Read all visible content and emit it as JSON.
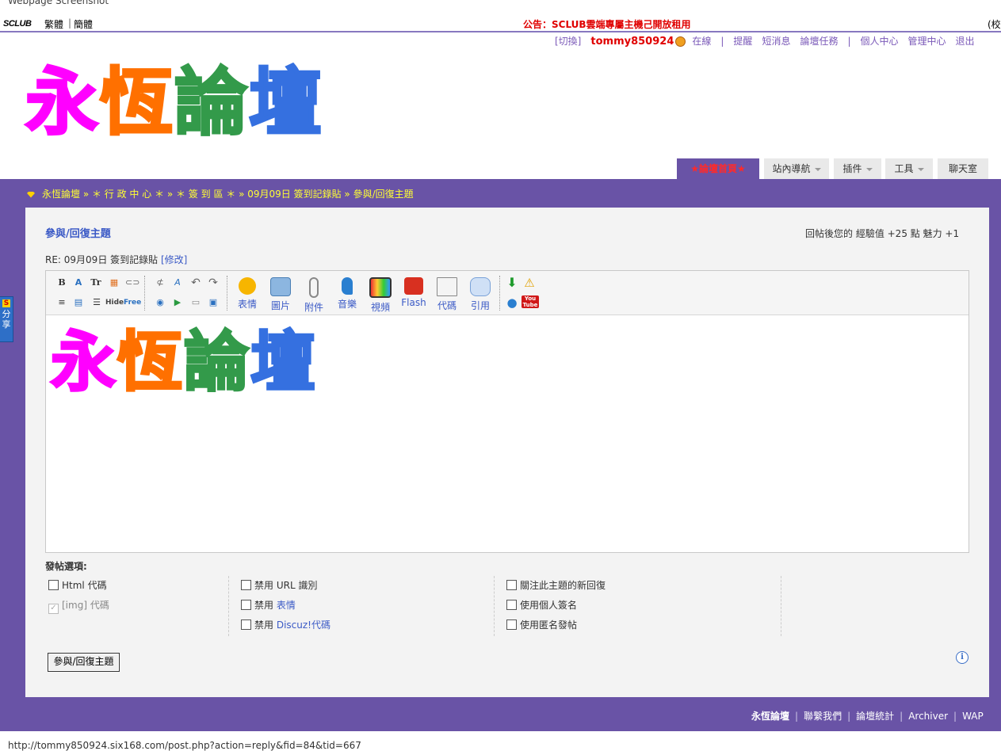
{
  "watermark": "Webpage Screenshot",
  "topbar": {
    "logo": "SCLUB",
    "lang_traditional": "繁體",
    "lang_separator": "|",
    "lang_simplified": "簡體",
    "announcement": "公告：SCLUB雲端專屬主機己開放租用",
    "right_fragment": "(校"
  },
  "user_nav": {
    "switch": "[切換]",
    "username": "tommy850924",
    "online": "在線",
    "sep": "|",
    "reminders": "提醒",
    "messages": "短消息",
    "tasks": "論壇任務",
    "profile": "個人中心",
    "admin": "管理中心",
    "logout": "退出"
  },
  "logo": {
    "chars": [
      "永",
      "恆",
      "論",
      "壇"
    ]
  },
  "nav_tabs": [
    {
      "label": "★論壇首頁★",
      "active": true
    },
    {
      "label": "站內導航",
      "dropdown": true
    },
    {
      "label": "插件",
      "dropdown": true
    },
    {
      "label": "工具",
      "dropdown": true
    },
    {
      "label": "聊天室"
    }
  ],
  "breadcrumb": "永恆論壇 » ＊ 行 政 中 心 ＊ » ＊ 簽 到 區 ＊ » 09月09日 簽到記錄貼 » 參與/回復主題",
  "share_tab": {
    "icon": "S",
    "label": "分享"
  },
  "post": {
    "heading": "參與/回復主題",
    "reward_note": "回帖後您的 經驗值 +25 點  魅力 +1",
    "subject": "RE: 09月09日 簽到記錄貼",
    "edit_link": "[修改]"
  },
  "toolbar": {
    "small_icons": [
      "bold-icon",
      "color-icon",
      "font-size-icon",
      "table-grid-icon",
      "link-icon",
      "unlink-icon",
      "clear-format-icon",
      "undo-icon",
      "redo-icon",
      "align-icon",
      "list-table-icon",
      "numbered-list-icon",
      "hide-icon",
      "free-icon",
      "globe-icon",
      "play-icon",
      "page-icon",
      "page-e-icon"
    ],
    "hide_label": "Hide",
    "free_label": "Free",
    "buttons": [
      {
        "label": "表情",
        "icon": "smiley-icon"
      },
      {
        "label": "圖片",
        "icon": "image-icon"
      },
      {
        "label": "附件",
        "icon": "attachment-icon"
      },
      {
        "label": "音樂",
        "icon": "music-icon"
      },
      {
        "label": "視頻",
        "icon": "video-icon"
      },
      {
        "label": "Flash",
        "icon": "flash-icon"
      },
      {
        "label": "代碼",
        "icon": "code-icon"
      },
      {
        "label": "引用",
        "icon": "quote-icon"
      }
    ],
    "youtube_label": "You Tube"
  },
  "options": {
    "title": "發帖選項:",
    "col1": [
      {
        "label": "Html 代碼",
        "checked": false
      },
      {
        "label": "[img] 代碼",
        "checked": true,
        "disabled": true
      }
    ],
    "col2": [
      {
        "prefix": "禁用",
        "label": "URL 識別",
        "link": false
      },
      {
        "prefix": "禁用",
        "label": "表情",
        "link": true
      },
      {
        "prefix": "禁用",
        "label": "Discuz!代碼",
        "link": true
      }
    ],
    "col3": [
      {
        "label": "關注此主題的新回復"
      },
      {
        "label": "使用個人簽名"
      },
      {
        "label": "使用匿名發帖"
      }
    ]
  },
  "submit_label": "參與/回復主題",
  "info_icon": "i",
  "footer": {
    "site": "永恆論壇",
    "contact": "聯繫我們",
    "stats": "論壇統計",
    "archiver": "Archiver",
    "wap": "WAP",
    "sep": "|"
  },
  "status_url": "http://tommy850924.six168.com/post.php?action=reply&fid=84&tid=667",
  "colors": {
    "purple": "#6953a6",
    "link": "#3b5ac6",
    "announce": "#e00000",
    "breadcrumb": "#ffff33"
  }
}
